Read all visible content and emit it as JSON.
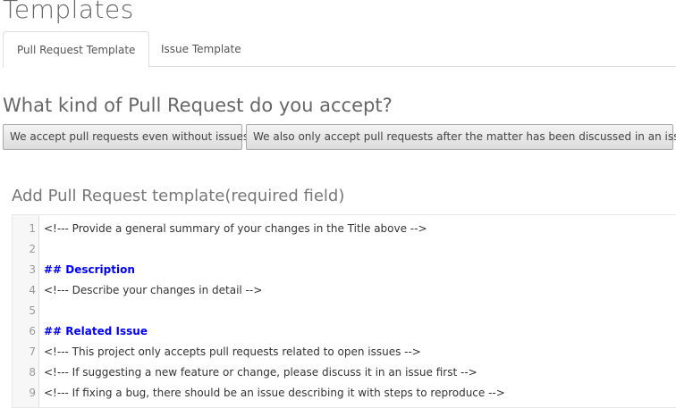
{
  "page_title": "Templates",
  "tabs": [
    {
      "label": "Pull Request Template",
      "active": true
    },
    {
      "label": "Issue Template",
      "active": false
    }
  ],
  "question": "What kind of Pull Request do you accept?",
  "buttons": [
    "We accept pull requests even without issues",
    "We also only accept pull requests after the matter has been discussed in an issue"
  ],
  "editor_title": "Add Pull Request template(required field)",
  "editor_lines": [
    {
      "n": "1",
      "text": "<!--- Provide a general summary of your changes in the Title above -->",
      "heading": false
    },
    {
      "n": "2",
      "text": "",
      "heading": false
    },
    {
      "n": "3",
      "text": "## Description",
      "heading": true
    },
    {
      "n": "4",
      "text": "<!--- Describe your changes in detail -->",
      "heading": false
    },
    {
      "n": "5",
      "text": "",
      "heading": false
    },
    {
      "n": "6",
      "text": "## Related Issue",
      "heading": true
    },
    {
      "n": "7",
      "text": "<!--- This project only accepts pull requests related to open issues -->",
      "heading": false
    },
    {
      "n": "8",
      "text": "<!--- If suggesting a new feature or change, please discuss it in an issue first -->",
      "heading": false
    },
    {
      "n": "9",
      "text": "<!--- If fixing a bug, there should be an issue describing it with steps to reproduce -->",
      "heading": false
    }
  ]
}
